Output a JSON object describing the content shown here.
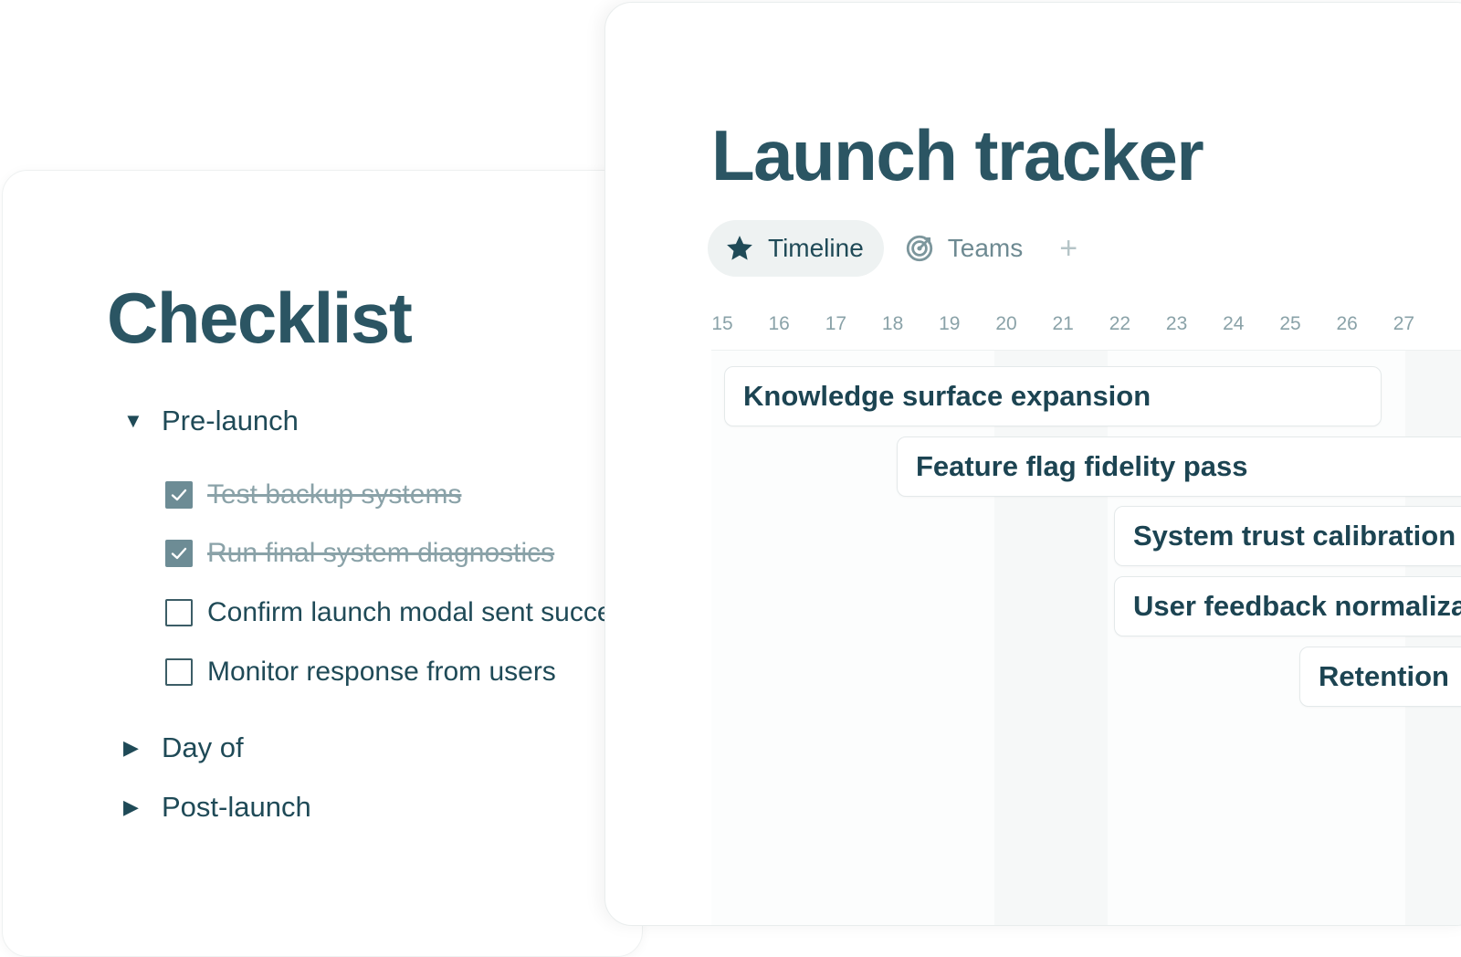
{
  "checklist": {
    "title": "Checklist",
    "sections": [
      {
        "label": "Pre-launch",
        "expanded": true
      },
      {
        "label": "Day of",
        "expanded": false
      },
      {
        "label": "Post-launch",
        "expanded": false
      }
    ],
    "tasks": [
      {
        "label": "Test backup systems",
        "done": true
      },
      {
        "label": "Run final system diagnostics",
        "done": true
      },
      {
        "label": "Confirm launch modal sent successfully",
        "done": false
      },
      {
        "label": "Monitor response from users",
        "done": false
      }
    ]
  },
  "tracker": {
    "title": "Launch tracker",
    "tabs": [
      {
        "label": "Timeline",
        "icon": "star-icon",
        "active": true
      },
      {
        "label": "Teams",
        "icon": "target-icon",
        "active": false
      }
    ],
    "add_tab": "+",
    "days": [
      "15",
      "16",
      "17",
      "18",
      "19",
      "20",
      "21",
      "22",
      "23",
      "24",
      "25",
      "26",
      "27"
    ],
    "tasks": [
      {
        "label": "Knowledge surface expansion",
        "start_day": "15",
        "end_day": "26"
      },
      {
        "label": "Feature flag fidelity pass",
        "start_day": "18"
      },
      {
        "label": "System trust calibration",
        "start_day": "22"
      },
      {
        "label": "User feedback normalization",
        "start_day": "22"
      },
      {
        "label": "Retention",
        "start_day": "25"
      }
    ]
  },
  "colors": {
    "title": "#2b5563",
    "text": "#1f4a57",
    "muted": "#8aa2a8",
    "checkbox_done": "#6d8c95"
  }
}
